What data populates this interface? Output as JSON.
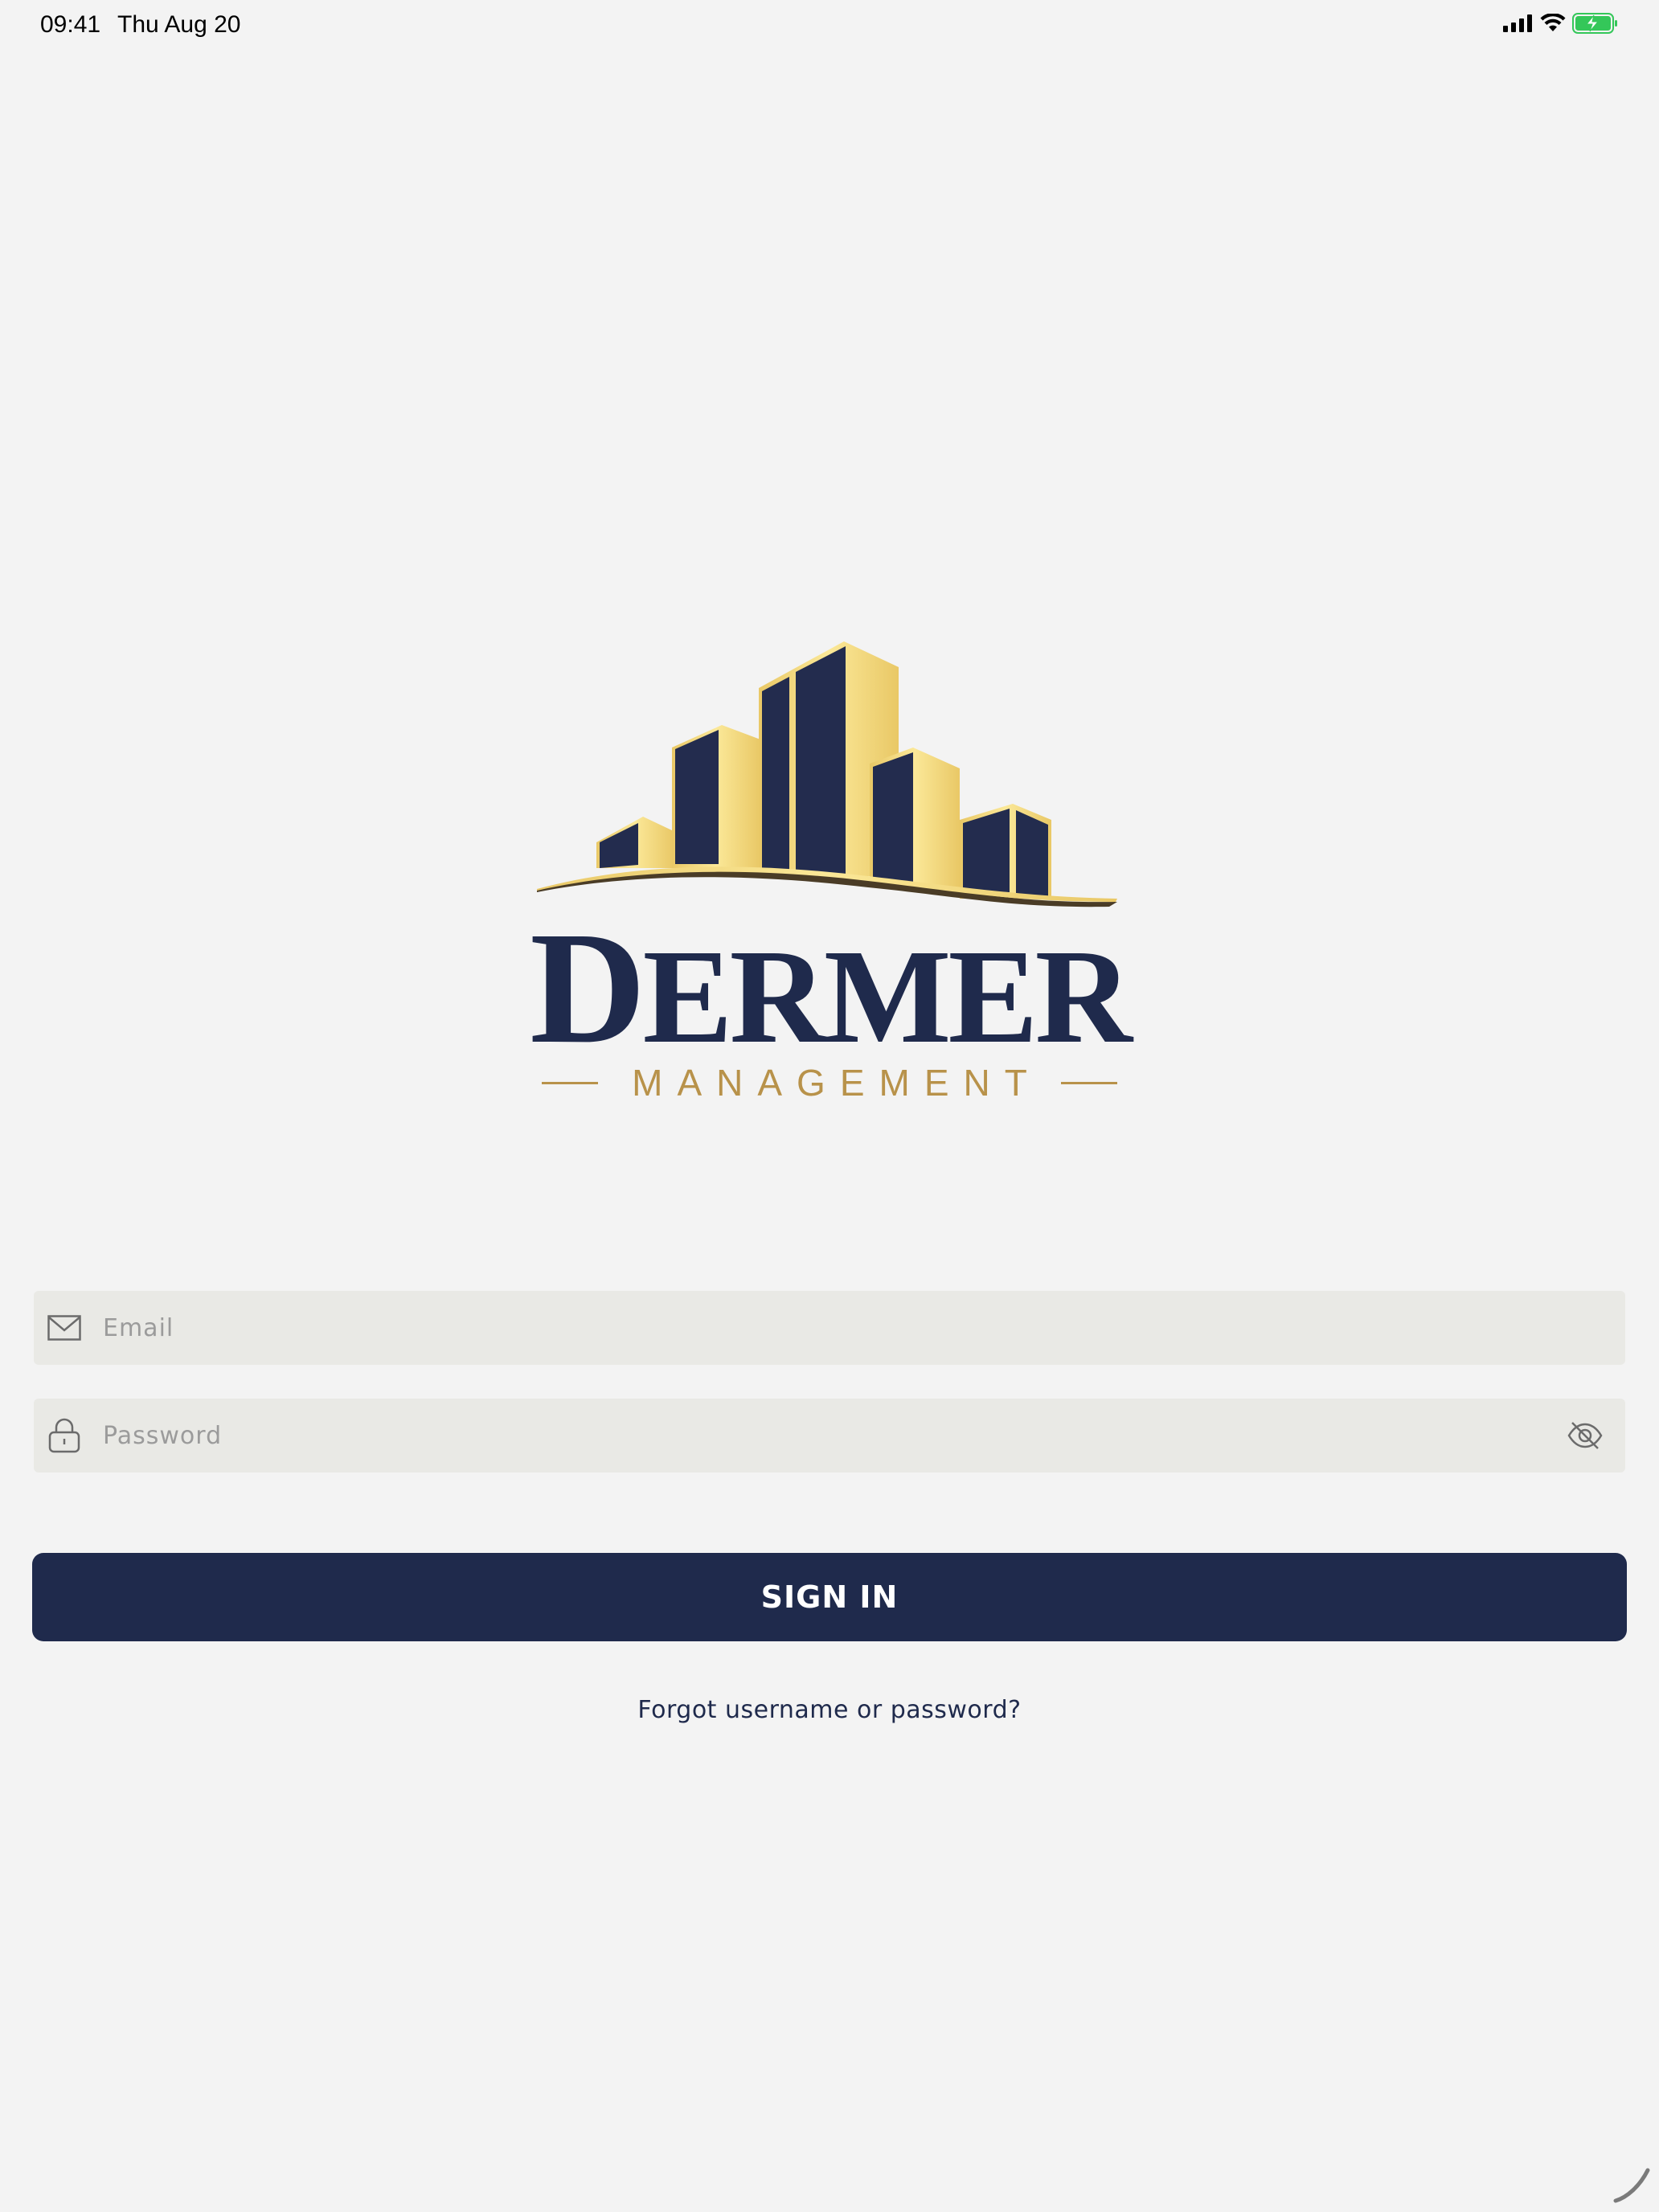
{
  "status_bar": {
    "time": "09:41",
    "date": "Thu Aug 20",
    "icons": [
      "cellular-signal-icon",
      "wifi-icon",
      "battery-charging-icon"
    ]
  },
  "logo": {
    "name_initial": "D",
    "name_rest": "ERMER",
    "tagline": "MANAGEMENT",
    "icon": "city-buildings-icon",
    "colors": {
      "navy": "#1f2a4c",
      "gold": "#f2d77a",
      "tagline_gold": "#b8924a"
    }
  },
  "form": {
    "email": {
      "placeholder": "Email",
      "value": "",
      "icon": "envelope-icon"
    },
    "password": {
      "placeholder": "Password",
      "value": "",
      "icon": "lock-icon",
      "toggle_icon": "eye-slash-icon"
    },
    "sign_in_label": "SIGN IN",
    "forgot_label": "Forgot username or password?"
  },
  "colors": {
    "background": "#f3f3f3",
    "field_background": "#e9e9e5",
    "button_background": "#1f2a4c",
    "button_text": "#ffffff",
    "battery_green": "#34c759"
  }
}
